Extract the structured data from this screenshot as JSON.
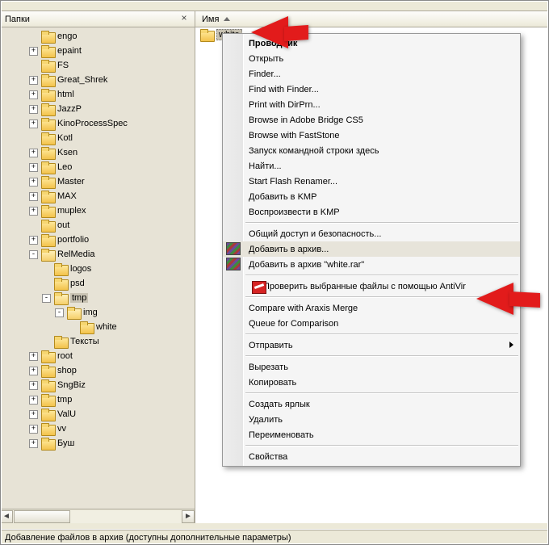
{
  "left": {
    "title": "Папки",
    "tree": [
      {
        "depth": 2,
        "label": "engo",
        "exp": "",
        "open": false
      },
      {
        "depth": 2,
        "label": "epaint",
        "exp": "+",
        "open": false
      },
      {
        "depth": 2,
        "label": "FS",
        "exp": "",
        "open": false
      },
      {
        "depth": 2,
        "label": "Great_Shrek",
        "exp": "+",
        "open": false
      },
      {
        "depth": 2,
        "label": "html",
        "exp": "+",
        "open": false
      },
      {
        "depth": 2,
        "label": "JazzP",
        "exp": "+",
        "open": false
      },
      {
        "depth": 2,
        "label": "KinoProcessSpec",
        "exp": "+",
        "open": false
      },
      {
        "depth": 2,
        "label": "Kotl",
        "exp": "",
        "open": false
      },
      {
        "depth": 2,
        "label": "Ksen",
        "exp": "+",
        "open": false
      },
      {
        "depth": 2,
        "label": "Leo",
        "exp": "+",
        "open": false
      },
      {
        "depth": 2,
        "label": "Master",
        "exp": "+",
        "open": false
      },
      {
        "depth": 2,
        "label": "MAX",
        "exp": "+",
        "open": false
      },
      {
        "depth": 2,
        "label": "muplex",
        "exp": "+",
        "open": false
      },
      {
        "depth": 2,
        "label": "out",
        "exp": "",
        "open": false
      },
      {
        "depth": 2,
        "label": "portfolio",
        "exp": "+",
        "open": false
      },
      {
        "depth": 2,
        "label": "RelMedia",
        "exp": "-",
        "open": true
      },
      {
        "depth": 3,
        "label": "logos",
        "exp": "",
        "open": false
      },
      {
        "depth": 3,
        "label": "psd",
        "exp": "",
        "open": false
      },
      {
        "depth": 3,
        "label": "tmp",
        "exp": "-",
        "open": true,
        "selected": true
      },
      {
        "depth": 4,
        "label": "img",
        "exp": "-",
        "open": true
      },
      {
        "depth": 5,
        "label": "white",
        "exp": "",
        "open": false
      },
      {
        "depth": 3,
        "label": "Тексты",
        "exp": "",
        "open": false
      },
      {
        "depth": 2,
        "label": "root",
        "exp": "+",
        "open": false
      },
      {
        "depth": 2,
        "label": "shop",
        "exp": "+",
        "open": false
      },
      {
        "depth": 2,
        "label": "SngBiz",
        "exp": "+",
        "open": false
      },
      {
        "depth": 2,
        "label": "tmp",
        "exp": "+",
        "open": false
      },
      {
        "depth": 2,
        "label": "ValU",
        "exp": "+",
        "open": false
      },
      {
        "depth": 2,
        "label": "vv",
        "exp": "+",
        "open": false
      },
      {
        "depth": 2,
        "label": "Буш",
        "exp": "+",
        "open": false
      }
    ]
  },
  "right": {
    "columnHeader": "Имя",
    "items": [
      {
        "label": "white",
        "selected": true
      }
    ]
  },
  "contextMenu": {
    "groups": [
      [
        {
          "label": "Проводник",
          "bold": true
        },
        {
          "label": "Открыть"
        },
        {
          "label": "Finder..."
        },
        {
          "label": "Find with Finder..."
        },
        {
          "label": "Print with DirPrn..."
        },
        {
          "label": "Browse in Adobe Bridge CS5"
        },
        {
          "label": "Browse with FastStone"
        },
        {
          "label": "Запуск командной строки здесь"
        },
        {
          "label": "Найти..."
        },
        {
          "label": "Start Flash Renamer..."
        },
        {
          "label": "Добавить в KMP"
        },
        {
          "label": "Воспроизвести в KMP"
        }
      ],
      [
        {
          "label": "Общий доступ и безопасность..."
        },
        {
          "label": "Добавить в архив...",
          "icon": "rar",
          "highlight": true
        },
        {
          "label": "Добавить в архив \"white.rar\"",
          "icon": "rar"
        }
      ],
      [
        {
          "label": "Проверить выбранные файлы с помощью AntiVir",
          "icon": "av"
        }
      ],
      [
        {
          "label": "Compare with Araxis Merge"
        },
        {
          "label": "Queue for Comparison"
        }
      ],
      [
        {
          "label": "Отправить",
          "submenu": true
        }
      ],
      [
        {
          "label": "Вырезать"
        },
        {
          "label": "Копировать"
        }
      ],
      [
        {
          "label": "Создать ярлык"
        },
        {
          "label": "Удалить"
        },
        {
          "label": "Переименовать"
        }
      ],
      [
        {
          "label": "Свойства"
        }
      ]
    ]
  },
  "status": "Добавление файлов в архив (доступны дополнительные параметры)"
}
